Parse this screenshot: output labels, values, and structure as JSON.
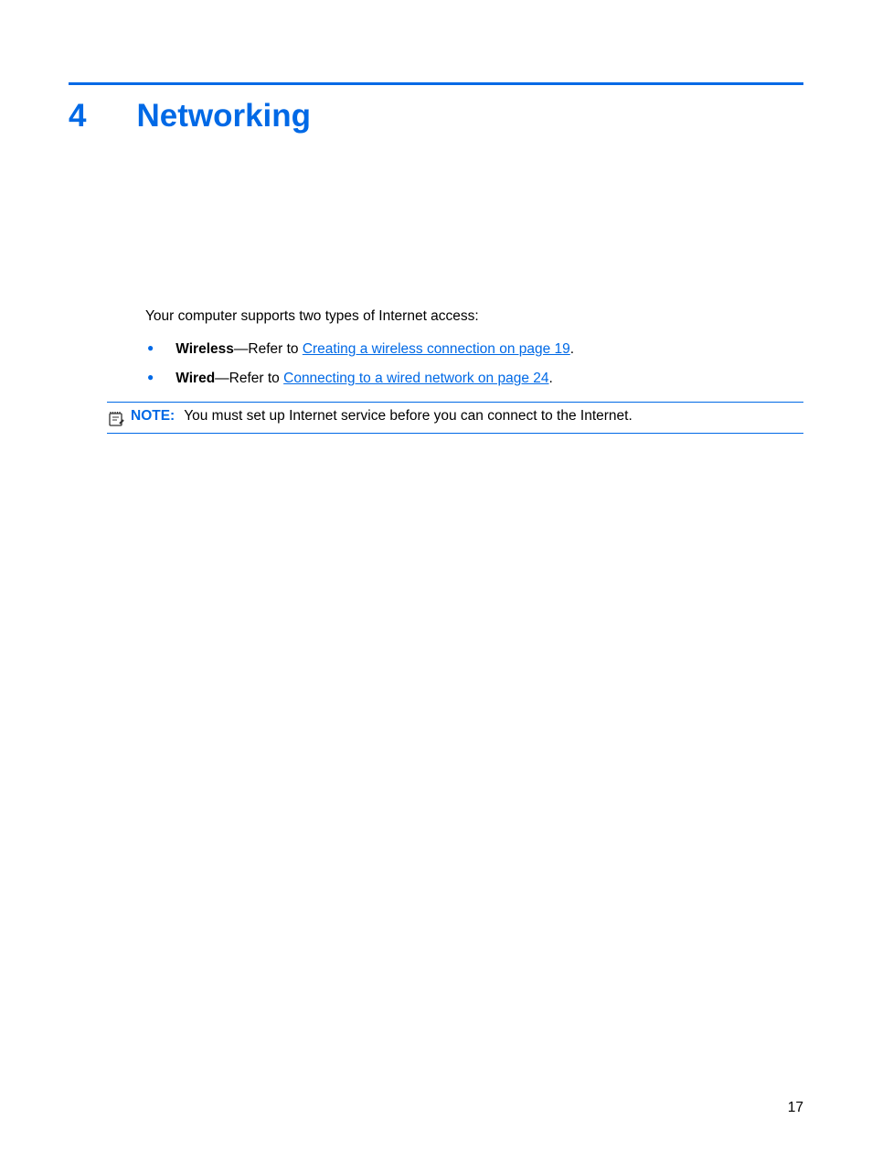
{
  "chapter": {
    "number": "4",
    "title": "Networking"
  },
  "content": {
    "intro": "Your computer supports two types of Internet access:",
    "bullets": [
      {
        "bold": "Wireless",
        "dash": "—Refer to ",
        "link": "Creating a wireless connection on page 19",
        "after": "."
      },
      {
        "bold": "Wired",
        "dash": "—Refer to ",
        "link": "Connecting to a wired network on page 24",
        "after": "."
      }
    ],
    "note": {
      "label": "NOTE:",
      "text": "You must set up Internet service before you can connect to the Internet."
    }
  },
  "page_number": "17"
}
